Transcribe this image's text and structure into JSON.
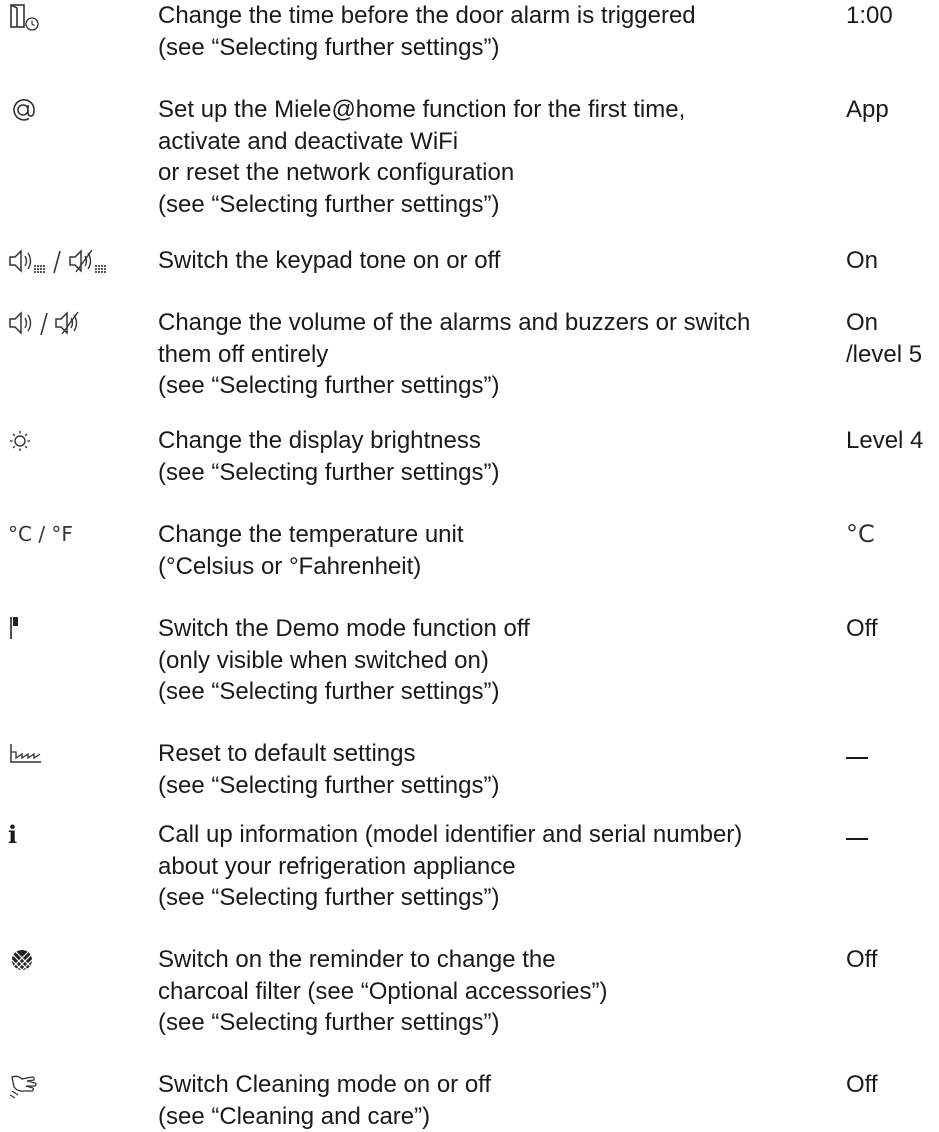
{
  "settings": [
    {
      "icon": "door-alarm-timer-icon",
      "lines": [
        "Change the time before the door alarm is triggered",
        "(see “Selecting further settings”)"
      ],
      "value": [
        "1:00"
      ]
    },
    {
      "icon": "at-sign-icon",
      "lines": [
        "Set up the Miele@home function for the first time,",
        "activate and deactivate WiFi",
        "or reset the network configuration",
        "(see “Selecting further settings”)"
      ],
      "value": [
        "App"
      ]
    },
    {
      "icon": "keypad-tone-icon",
      "lines": [
        "Switch the keypad tone on or off"
      ],
      "value": [
        "On"
      ]
    },
    {
      "icon": "volume-icon",
      "lines": [
        "Change the volume of the alarms and buzzers or switch",
        "them off entirely",
        "(see “Selecting further settings”)"
      ],
      "value": [
        "On",
        "/level 5"
      ]
    },
    {
      "icon": "brightness-icon",
      "lines": [
        "Change the display brightness",
        "(see “Selecting further settings”)"
      ],
      "value": [
        "Level 4"
      ]
    },
    {
      "icon": "temperature-unit-icon",
      "icon_text": "°C / °F",
      "lines": [
        "Change the temperature unit",
        "(°Celsius or °Fahrenheit)"
      ],
      "value": [
        "°C"
      ]
    },
    {
      "icon": "demo-mode-flag-icon",
      "lines": [
        "Switch the Demo mode function off",
        "(only visible when switched on)",
        "(see “Selecting further settings”)"
      ],
      "value": [
        "Off"
      ]
    },
    {
      "icon": "factory-reset-icon",
      "lines": [
        "Reset to default settings",
        "(see “Selecting further settings”)"
      ],
      "value": []
    },
    {
      "icon": "info-icon",
      "icon_text": "i",
      "lines": [
        "Call up information (model identifier and serial number)",
        "about your refrigeration appliance",
        "(see “Selecting further settings”)"
      ],
      "value": []
    },
    {
      "icon": "charcoal-filter-icon",
      "lines": [
        "Switch on the reminder to change the",
        "charcoal filter (see “Optional accessories”)",
        "(see “Selecting further settings”)"
      ],
      "value": [
        "Off"
      ]
    },
    {
      "icon": "cleaning-mode-hand-icon",
      "lines": [
        "Switch Cleaning mode on or off",
        "(see “Cleaning and care”)"
      ],
      "value": [
        "Off"
      ]
    }
  ]
}
